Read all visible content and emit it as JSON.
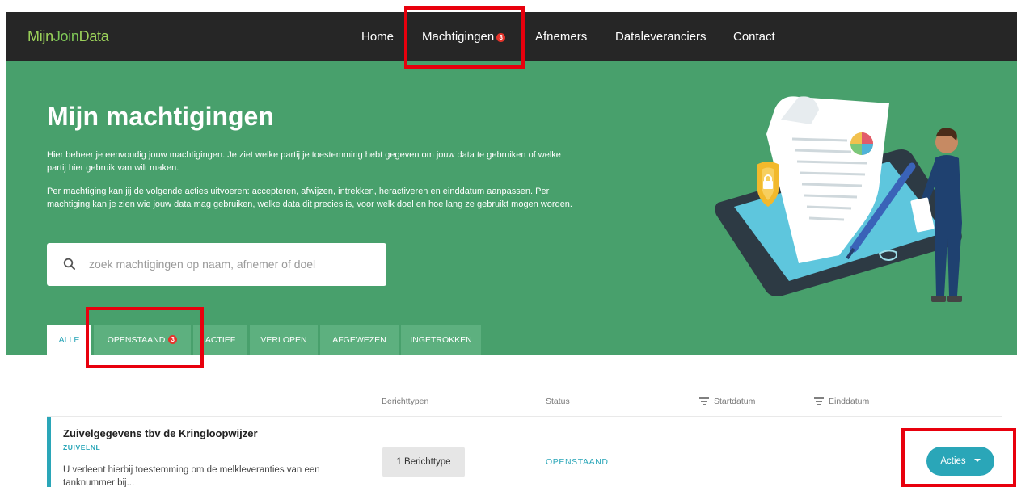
{
  "brand": {
    "logo_prefix": "Mijn",
    "logo_join": "Join",
    "logo_suffix": "Data"
  },
  "nav": {
    "items": [
      {
        "label": "Home"
      },
      {
        "label": "Machtigingen",
        "badge": "3"
      },
      {
        "label": "Afnemers"
      },
      {
        "label": "Dataleveranciers"
      },
      {
        "label": "Contact"
      }
    ]
  },
  "hero": {
    "title": "Mijn machtigingen",
    "paragraph1": "Hier beheer je eenvoudig jouw machtigingen. Je ziet welke partij je toestemming hebt gegeven om jouw data te gebruiken of welke partij hier gebruik van wilt maken.",
    "paragraph2": "Per machtiging kan jij de volgende acties uitvoeren: accepteren, afwijzen, intrekken, heractiveren en einddatum aanpassen. Per machtiging kan je zien wie jouw data mag gebruiken, welke data dit precies is, voor welk doel en hoe lang ze gebruikt mogen worden."
  },
  "search": {
    "placeholder": "zoek machtigingen op naam, afnemer of doel",
    "value": ""
  },
  "tabs": [
    {
      "label": "ALLE",
      "active": true
    },
    {
      "label": "OPENSTAAND",
      "badge": "3"
    },
    {
      "label": "ACTIEF"
    },
    {
      "label": "VERLOPEN"
    },
    {
      "label": "AFGEWEZEN"
    },
    {
      "label": "INGETROKKEN"
    }
  ],
  "table": {
    "headers": {
      "berichttypen": "Berichttypen",
      "status": "Status",
      "startdatum": "Startdatum",
      "einddatum": "Einddatum"
    },
    "rows": [
      {
        "title": "Zuivelgegevens tbv de Kringloopwijzer",
        "org": "ZUIVELNL",
        "description": "U verleent hierbij toestemming om de melkleveranties van een tanknummer bij...",
        "berichttypen": "1 Berichttype",
        "status": "OPENSTAAND",
        "action": "Acties"
      }
    ]
  },
  "colors": {
    "accent": "#2aa6b8",
    "hero": "#48a06c",
    "nav": "#262626",
    "badge": "#e5332a",
    "annotation": "#e8000d"
  }
}
